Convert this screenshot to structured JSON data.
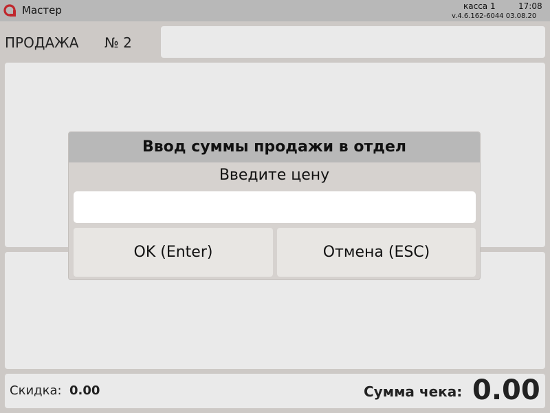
{
  "topbar": {
    "app_name": "Мастер",
    "kassa": "касса 1",
    "time": "17:08",
    "version": "v.4.6.162-6044  03.08.20",
    "logo_color": "#c0272d"
  },
  "header": {
    "sale_label": "ПРОДАЖА",
    "sale_number": "№ 2"
  },
  "footer": {
    "discount_label": "Скидка:",
    "discount_value": "0.00",
    "total_label": "Сумма чека:",
    "total_value": "0.00"
  },
  "dialog": {
    "title": "Ввод суммы продажи в отдел",
    "prompt": "Введите цену",
    "input_value": "",
    "ok_label": "OK (Enter)",
    "cancel_label": "Отмена (ESC)"
  },
  "icons": {
    "logo": "app-logo-icon"
  }
}
